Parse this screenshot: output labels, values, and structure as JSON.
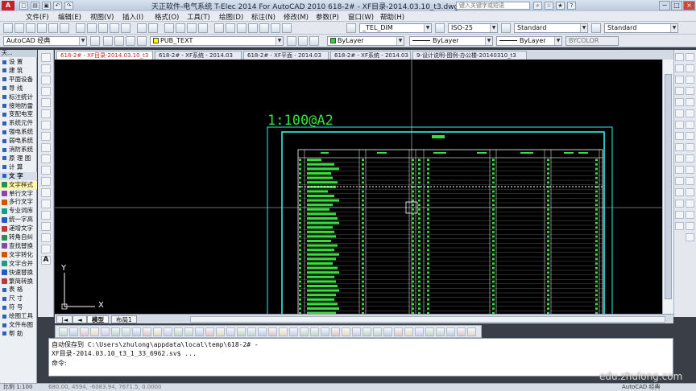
{
  "window": {
    "title": "天正软件-电气系统 T-Elec 2014  For AutoCAD 2010      618-2# - XF目录-2014.03.10_t3.dwg",
    "logo_glyph": "A",
    "search_placeholder": "键入关键字或短语",
    "controls": [
      "−",
      "□",
      "×"
    ]
  },
  "menu": {
    "items": [
      "文件(F)",
      "编辑(E)",
      "视图(V)",
      "插入(I)",
      "格式(O)",
      "工具(T)",
      "绘图(D)",
      "标注(N)",
      "修改(M)",
      "参数(P)",
      "窗口(W)",
      "帮助(H)"
    ]
  },
  "toolbar1": {
    "text_style_value": "_TEL_DIM",
    "dim_style_value": "ISO-25",
    "table_style_value": "Standard",
    "multileader_style_value": "Standard"
  },
  "toolbar2": {
    "workspace_value": "AutoCAD 经典",
    "layer_value": "PUB_TEXT",
    "color_value": "ByLayer",
    "linetype_value": "ByLayer",
    "lineweight_value": "ByLayer",
    "plotstyle_value": "BYCOLOR",
    "layer_color": "#ffff00",
    "color_swatch": "#33cc33"
  },
  "left_palette": {
    "title": "天...",
    "items": [
      {
        "label": "设    置",
        "type": "item"
      },
      {
        "label": "建    筑",
        "type": "item"
      },
      {
        "label": "平面设备",
        "type": "item"
      },
      {
        "label": "导    线",
        "type": "item"
      },
      {
        "label": "标注统计",
        "type": "item"
      },
      {
        "label": "接地防雷",
        "type": "item"
      },
      {
        "label": "变配电室",
        "type": "item"
      },
      {
        "label": "系统元件",
        "type": "item"
      },
      {
        "label": "强电系统",
        "type": "item"
      },
      {
        "label": "弱电系统",
        "type": "item"
      },
      {
        "label": "消防系统",
        "type": "item"
      },
      {
        "label": "原 理 图",
        "type": "item"
      },
      {
        "label": "计    算",
        "type": "item"
      },
      {
        "label": "文    字",
        "type": "section"
      },
      {
        "label": "文字样式",
        "type": "sub"
      },
      {
        "label": "单行文字",
        "type": "sub"
      },
      {
        "label": "多行文字",
        "type": "sub"
      },
      {
        "label": "专业词库",
        "type": "sub"
      },
      {
        "label": "统一字高",
        "type": "sub"
      },
      {
        "label": "递增文字",
        "type": "sub"
      },
      {
        "label": "转角自纠",
        "type": "sub"
      },
      {
        "label": "查找替换",
        "type": "sub"
      },
      {
        "label": "文字转化",
        "type": "sub"
      },
      {
        "label": "文字合并",
        "type": "sub"
      },
      {
        "label": "快速替换",
        "type": "sub"
      },
      {
        "label": "繁简转换",
        "type": "sub"
      },
      {
        "label": "表    格",
        "type": "item"
      },
      {
        "label": "尺    寸",
        "type": "item"
      },
      {
        "label": "符    号",
        "type": "item"
      },
      {
        "label": "绘图工具",
        "type": "item"
      },
      {
        "label": "文件布图",
        "type": "item"
      },
      {
        "label": "帮    助",
        "type": "item"
      }
    ]
  },
  "doc_tabs": [
    {
      "label": "618-2# - XF目录-2014.03.10_t3",
      "active": true
    },
    {
      "label": "618-2# - XF系统 - 2014.03",
      "active": false
    },
    {
      "label": "618-2# - XF平面 - 2014.03",
      "active": false
    },
    {
      "label": "618-2# - XF系统 - 2014.03",
      "active": false
    },
    {
      "label": "9-设计说明-图例-办公楼-20140310_t3",
      "active": false
    }
  ],
  "canvas": {
    "scale_label": "1:100@A2",
    "background": "#000000",
    "frame_color": "#2ef0e8",
    "table_color": "#ffffff",
    "text_color": "#35e13a",
    "ucs_y": "Y",
    "ucs_x": "X"
  },
  "layout_tabs": {
    "model_label": "模型",
    "layout_label": "布局1"
  },
  "command": {
    "line1": "自动保存到 C:\\Users\\zhulong\\appdata\\local\\temp\\618-2# -",
    "line2": "XF目录-2014.03.10_t3_1_33_6962.sv$ ...",
    "prompt": "命令:"
  },
  "status": {
    "scale": "比例 1:100",
    "coords": "680.00, 4594, -6083.94, 7671.5, 0.0000",
    "workspace": "AutoCAD 经典"
  },
  "watermark": "edu.zhulong.com"
}
